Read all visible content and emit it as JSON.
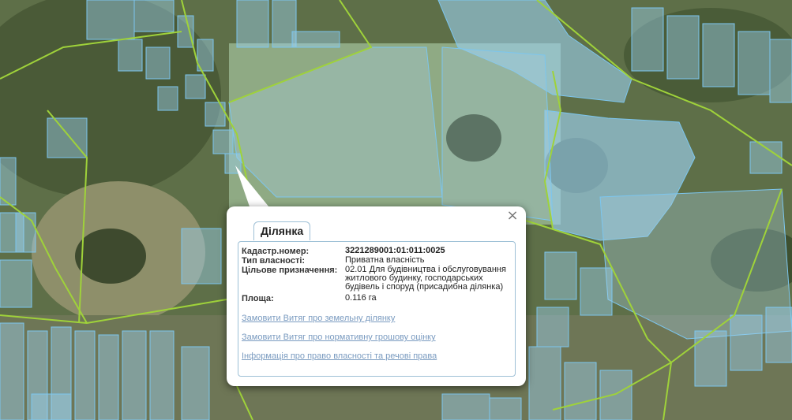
{
  "colors": {
    "parcel_stroke": "#7cc6ef",
    "parcel_fill": "#9bd0ee",
    "boundary_line": "#9fd23a",
    "link": "#7a9bc0",
    "tab_border": "#9ec0d6"
  },
  "popup": {
    "tab_label": "Ділянка",
    "close_symbol": "×",
    "fields": [
      {
        "label": "Кадастр.номер:",
        "value": "3221289001:01:011:0025",
        "bold": true
      },
      {
        "label": "Тип власності:",
        "value": "Приватна власність",
        "bold": false
      },
      {
        "label": "Цільове призначення:",
        "value": "02.01 Для будівництва і обслуговування житлового будинку, господарських будівель і споруд (присадибна ділянка)",
        "bold": false
      },
      {
        "label": "Площа:",
        "value": "0.116 га",
        "bold": false
      }
    ],
    "links": [
      "Замовити Витяг про земельну ділянку",
      "Замовити Витяг про нормативну грошову оцінку",
      "Інформація про право власності та речові права"
    ]
  }
}
